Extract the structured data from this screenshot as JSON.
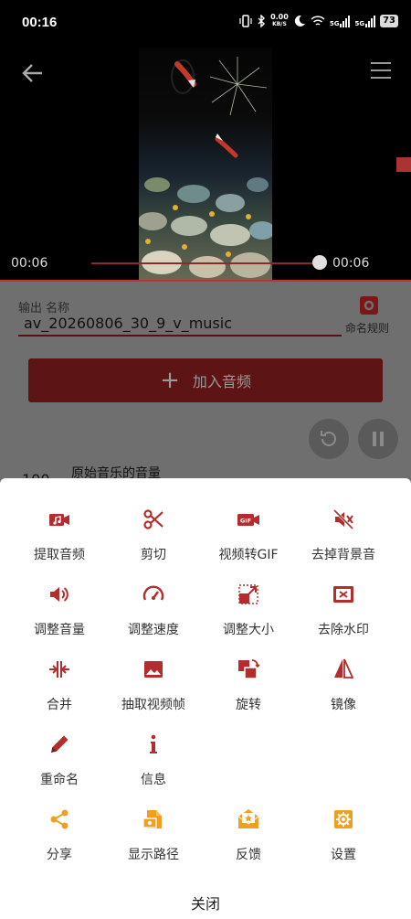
{
  "status_bar": {
    "time": "00:16",
    "net_speed_value": "0.00",
    "net_speed_unit": "KB/S",
    "signal1": "5G",
    "signal2": "5G",
    "battery": "73"
  },
  "player": {
    "time_current": "00:06",
    "time_total": "00:06",
    "progress": 1.0
  },
  "form": {
    "output_label": "输出 名称",
    "filename": "av_20260806_30_9_v_music",
    "naming_rule_label": "命名规则",
    "add_audio_label": "加入音频",
    "volume_value": "100",
    "volume_label": "原始音乐的音量"
  },
  "sheet": {
    "accent_color": "#b32d2d",
    "secondary_color": "#f0a020",
    "rows": [
      [
        {
          "label": "提取音频",
          "icon": "music-video-icon"
        },
        {
          "label": "剪切",
          "icon": "scissors-icon"
        },
        {
          "label": "视频转GIF",
          "icon": "gif-icon"
        },
        {
          "label": "去掉背景音",
          "icon": "mute-icon"
        }
      ],
      [
        {
          "label": "调整音量",
          "icon": "volume-icon"
        },
        {
          "label": "调整速度",
          "icon": "speedometer-icon"
        },
        {
          "label": "调整大小",
          "icon": "resize-icon"
        },
        {
          "label": "去除水印",
          "icon": "remove-watermark-icon"
        }
      ],
      [
        {
          "label": "合并",
          "icon": "merge-icon"
        },
        {
          "label": "抽取视频帧",
          "icon": "image-icon"
        },
        {
          "label": "旋转",
          "icon": "rotate-icon"
        },
        {
          "label": "镜像",
          "icon": "mirror-icon"
        }
      ],
      [
        {
          "label": "重命名",
          "icon": "pencil-icon"
        },
        {
          "label": "信息",
          "icon": "info-icon"
        }
      ],
      [
        {
          "label": "分享",
          "icon": "share-icon"
        },
        {
          "label": "显示路径",
          "icon": "file-path-icon"
        },
        {
          "label": "反馈",
          "icon": "feedback-mail-icon"
        },
        {
          "label": "设置",
          "icon": "settings-gear-icon"
        }
      ]
    ],
    "close_label": "关闭"
  }
}
